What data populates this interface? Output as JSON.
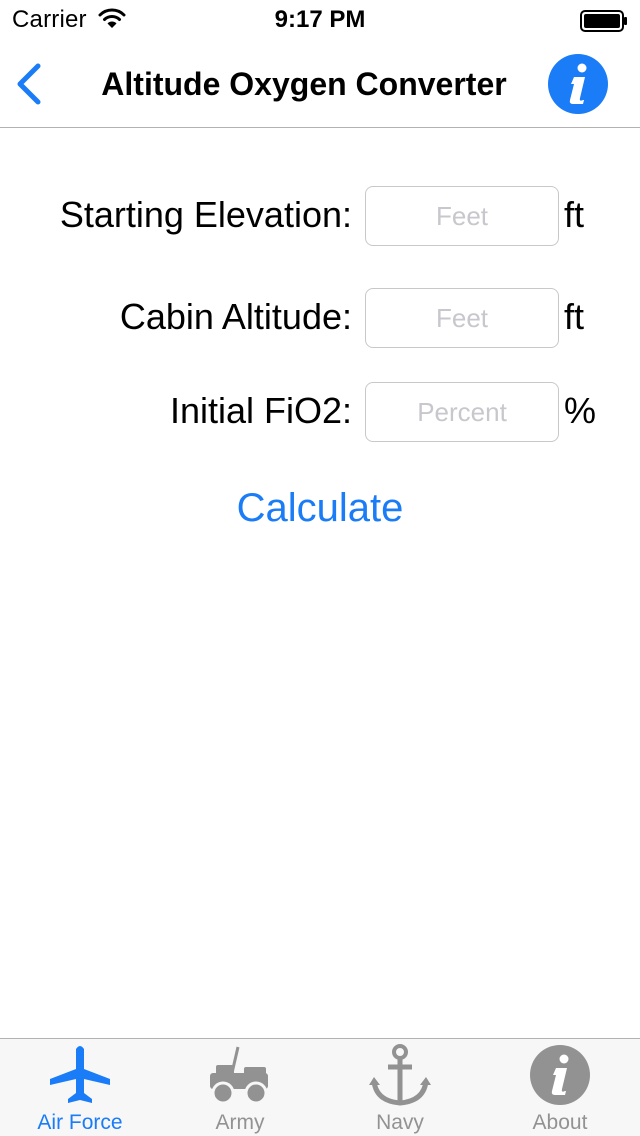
{
  "status_bar": {
    "carrier": "Carrier",
    "time": "9:17 PM",
    "icons": [
      "wifi-icon",
      "battery-icon"
    ]
  },
  "nav": {
    "title": "Altitude Oxygen Converter",
    "back_icon": "chevron-left-icon",
    "info_icon": "info-icon",
    "accent": "#1a7cf6"
  },
  "form": {
    "starting_elevation": {
      "label": "Starting Elevation:",
      "placeholder": "Feet",
      "value": "",
      "unit": "ft"
    },
    "cabin_altitude": {
      "label": "Cabin Altitude:",
      "placeholder": "Feet",
      "value": "",
      "unit": "ft"
    },
    "initial_fio2": {
      "label": "Initial FiO2:",
      "placeholder": "Percent",
      "value": "",
      "unit": "%"
    },
    "calculate_label": "Calculate"
  },
  "tabs": [
    {
      "label": "Air Force",
      "icon": "airplane-icon",
      "active": true
    },
    {
      "label": "Army",
      "icon": "jeep-icon",
      "active": false
    },
    {
      "label": "Navy",
      "icon": "anchor-icon",
      "active": false
    },
    {
      "label": "About",
      "icon": "info-icon",
      "active": false
    }
  ],
  "colors": {
    "active": "#1a7cf6",
    "inactive": "#929292"
  }
}
